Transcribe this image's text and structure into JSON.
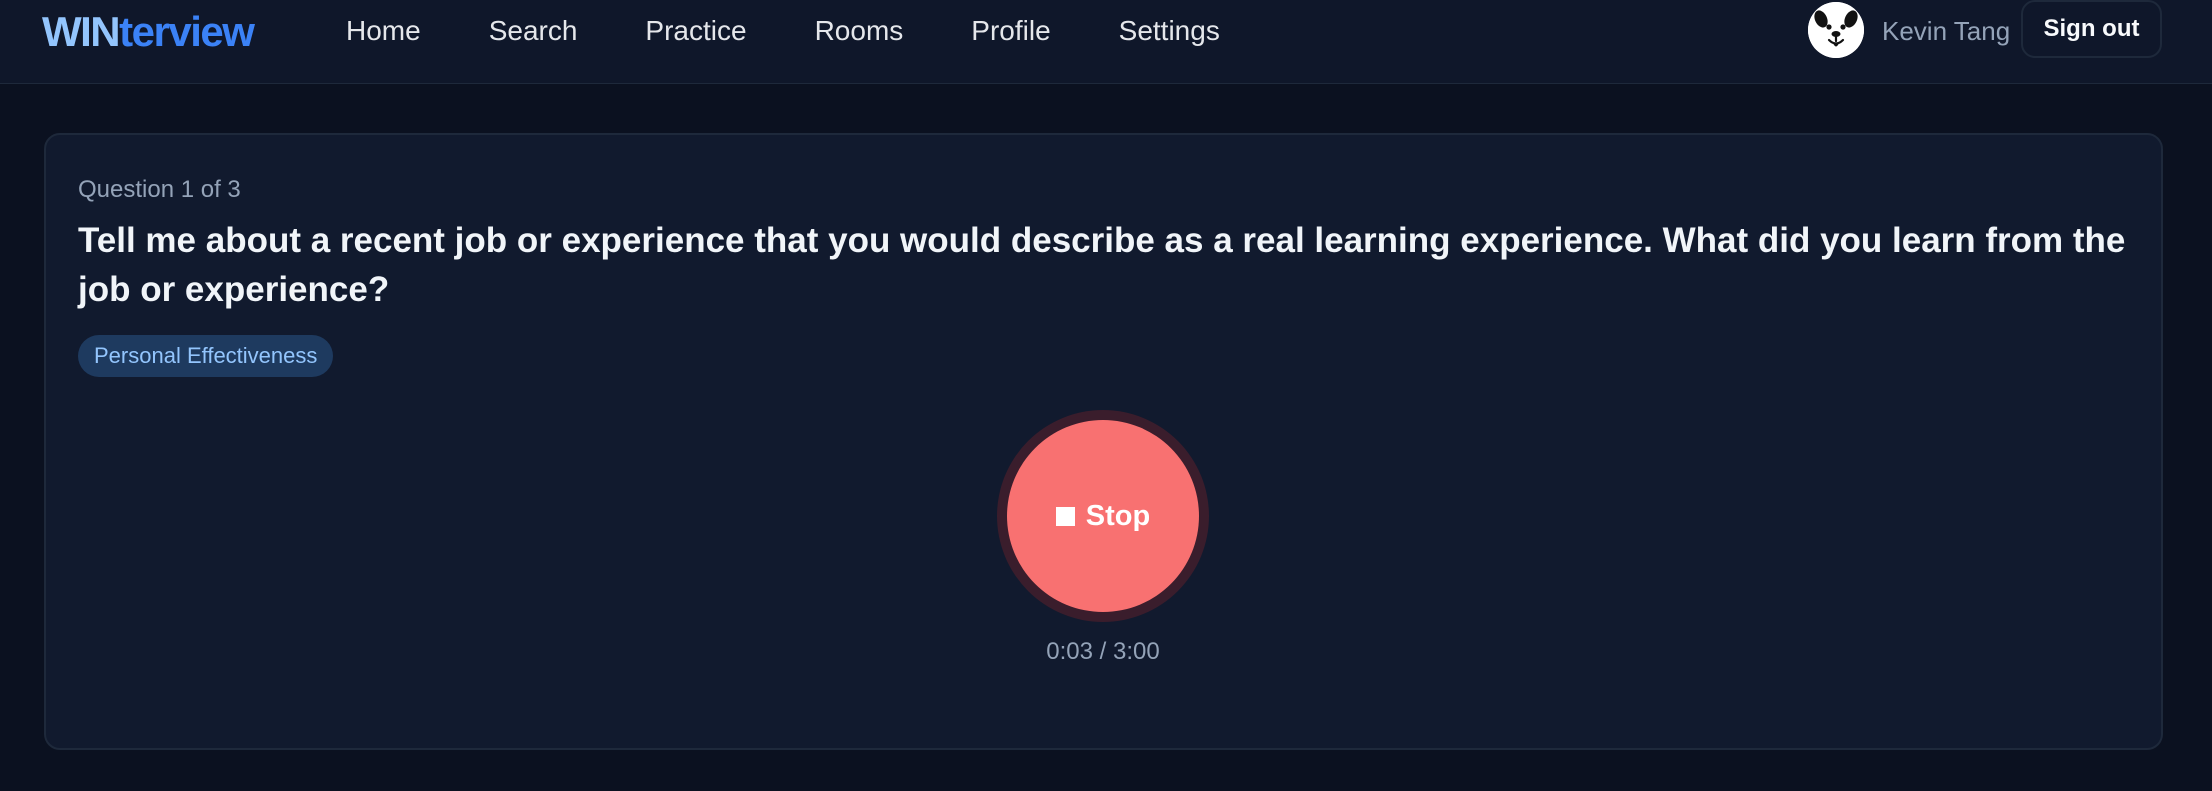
{
  "brand": {
    "logo_part1": "WIN",
    "logo_part2": "terview",
    "colors": {
      "primary": "#3b82f6",
      "light": "#93c5fd"
    }
  },
  "nav": {
    "items": [
      {
        "label": "Home"
      },
      {
        "label": "Search"
      },
      {
        "label": "Practice"
      },
      {
        "label": "Rooms"
      },
      {
        "label": "Profile"
      },
      {
        "label": "Settings"
      }
    ]
  },
  "user": {
    "name": "Kevin Tang",
    "avatar_icon": "dog-face-icon",
    "signout_label": "Sign out"
  },
  "question": {
    "counter": "Question 1 of 3",
    "text": "Tell me about a recent job or experience that you would describe as a real learning experience. What did you learn from the job or experience?",
    "tag": "Personal Effectiveness"
  },
  "recorder": {
    "stop_label": "Stop",
    "stop_icon": "stop-square-icon",
    "timer": "0:03 / 3:00",
    "button_color": "#f87171"
  }
}
